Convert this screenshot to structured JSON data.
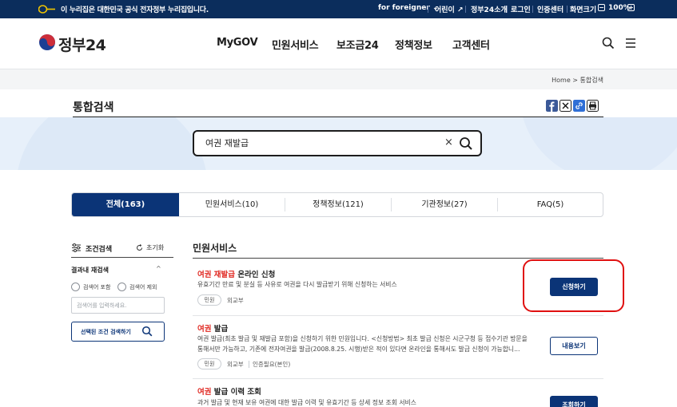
{
  "gov_banner": {
    "text": "이 누리집은 대한민국 공식 전자정부 누리집입니다.",
    "utilities": [
      "for foreigner",
      "어린이",
      "정부24소개",
      "로그인",
      "인증센터",
      "화면크기",
      "100%"
    ]
  },
  "header": {
    "logo_text": "정부24",
    "nav": [
      "MyGOV",
      "민원서비스",
      "보조금24",
      "정책정보",
      "고객센터"
    ]
  },
  "breadcrumb": {
    "home": "Home",
    "sep": ">",
    "current": "통합검색"
  },
  "page_title": "통합검색",
  "search": {
    "value": "여권 재발급",
    "clear": "×"
  },
  "tabs": [
    "전체(163)",
    "민원서비스(10)",
    "정책정보(121)",
    "기관정보(27)",
    "FAQ(5)"
  ],
  "sidebar": {
    "title": "조건검색",
    "reset": "초기화",
    "re_search_label": "결과내 재검색",
    "caret": "^",
    "opt_include": "검색어 포함",
    "opt_exclude": "검색어 제외",
    "input_placeholder": "검색어를 입력하세요.",
    "button": "선택된 조건 검색하기"
  },
  "results": {
    "section_title": "민원서비스",
    "items": [
      {
        "title_hl": "여권 재발급",
        "title_rest": " 온라인 신청",
        "desc": "유효기간 만료 및 분실 등 사유로 여권을 다시 발급받기 위해 신청하는 서비스",
        "desc2": "",
        "chip": "민원",
        "agency": "외교부",
        "extra": "",
        "button": "신청하기"
      },
      {
        "title_hl": "여권",
        "title_rest": " 발급",
        "desc": "여권 발급(최초 발급 및 재발급 포함)을 신청하기 위한 민원입니다. <신청방법> 최초 발급 신청은 시군구청 등 접수기관 방문을",
        "desc2": "통해서만 가능하고, 기존에 전자여권을 발급(2008.8.25. 시행)받은 적이 있다면 온라인을 통해서도 발급 신청이 가능합니...",
        "chip": "민원",
        "agency": "외교부",
        "extra": "인증필요(본인)",
        "button": "내용보기"
      },
      {
        "title_hl": "여권",
        "title_rest": " 발급 이력 조회",
        "desc": "과거 발급 및 현재 보유 여권에 대한 발급 이력 및 유효기간 등 상세 정보 조회 서비스",
        "button": "조회하기"
      }
    ]
  }
}
